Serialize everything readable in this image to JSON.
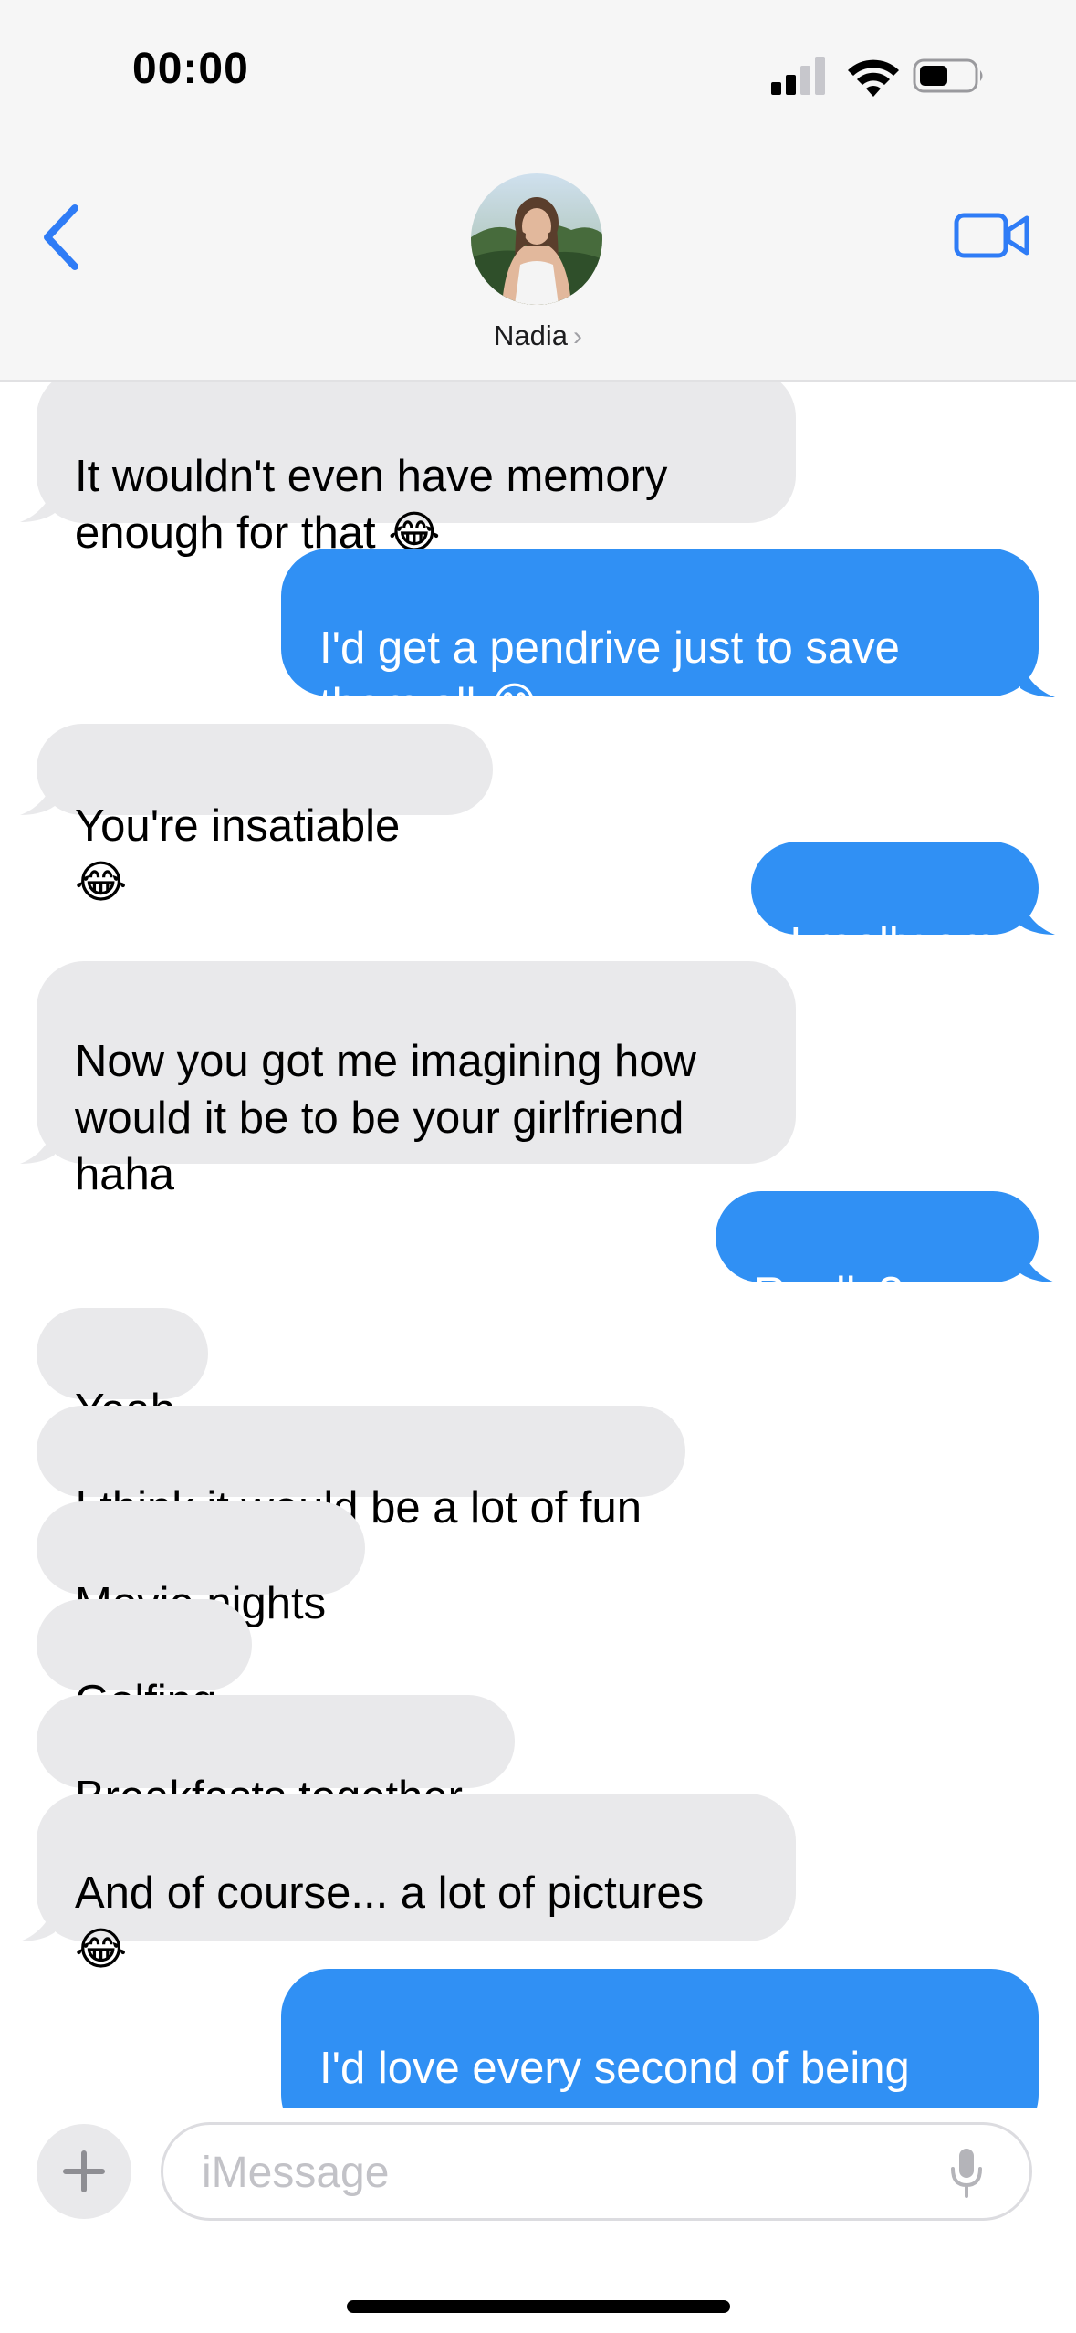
{
  "status_bar": {
    "time": "00:00"
  },
  "header": {
    "contact_name": "Nadia",
    "chevron": "›"
  },
  "messages": [
    {
      "dir": "in",
      "text": "It wouldn't even have memory\nenough for that 😂"
    },
    {
      "dir": "out",
      "text": "I'd get a pendrive just to save\nthem all 😂"
    },
    {
      "dir": "in",
      "text": "You're insatiable 😂"
    },
    {
      "dir": "out",
      "text": "I really am"
    },
    {
      "dir": "in",
      "text": "Now you got me imagining how\nwould it be to be your girlfriend\nhaha"
    },
    {
      "dir": "out",
      "text": "Really? haha"
    },
    {
      "dir": "in",
      "text": "Yeah"
    },
    {
      "dir": "in",
      "text": "I think it would be a lot of fun"
    },
    {
      "dir": "in",
      "text": "Movie nights"
    },
    {
      "dir": "in",
      "text": "Golfing"
    },
    {
      "dir": "in",
      "text": "Breakfasts together"
    },
    {
      "dir": "in",
      "text": "And of course... a lot of pictures\n😂"
    },
    {
      "dir": "out",
      "text": "I'd love every second of being your\nboyfriend"
    }
  ],
  "input": {
    "placeholder": "iMessage"
  },
  "icons": {
    "back": "chevron-left-icon",
    "video": "video-camera-icon",
    "plus": "plus-icon",
    "mic": "microphone-icon"
  },
  "colors": {
    "outgoing_bubble": "#3090f4",
    "incoming_bubble": "#e9e9eb",
    "accent": "#2f7cf6"
  }
}
